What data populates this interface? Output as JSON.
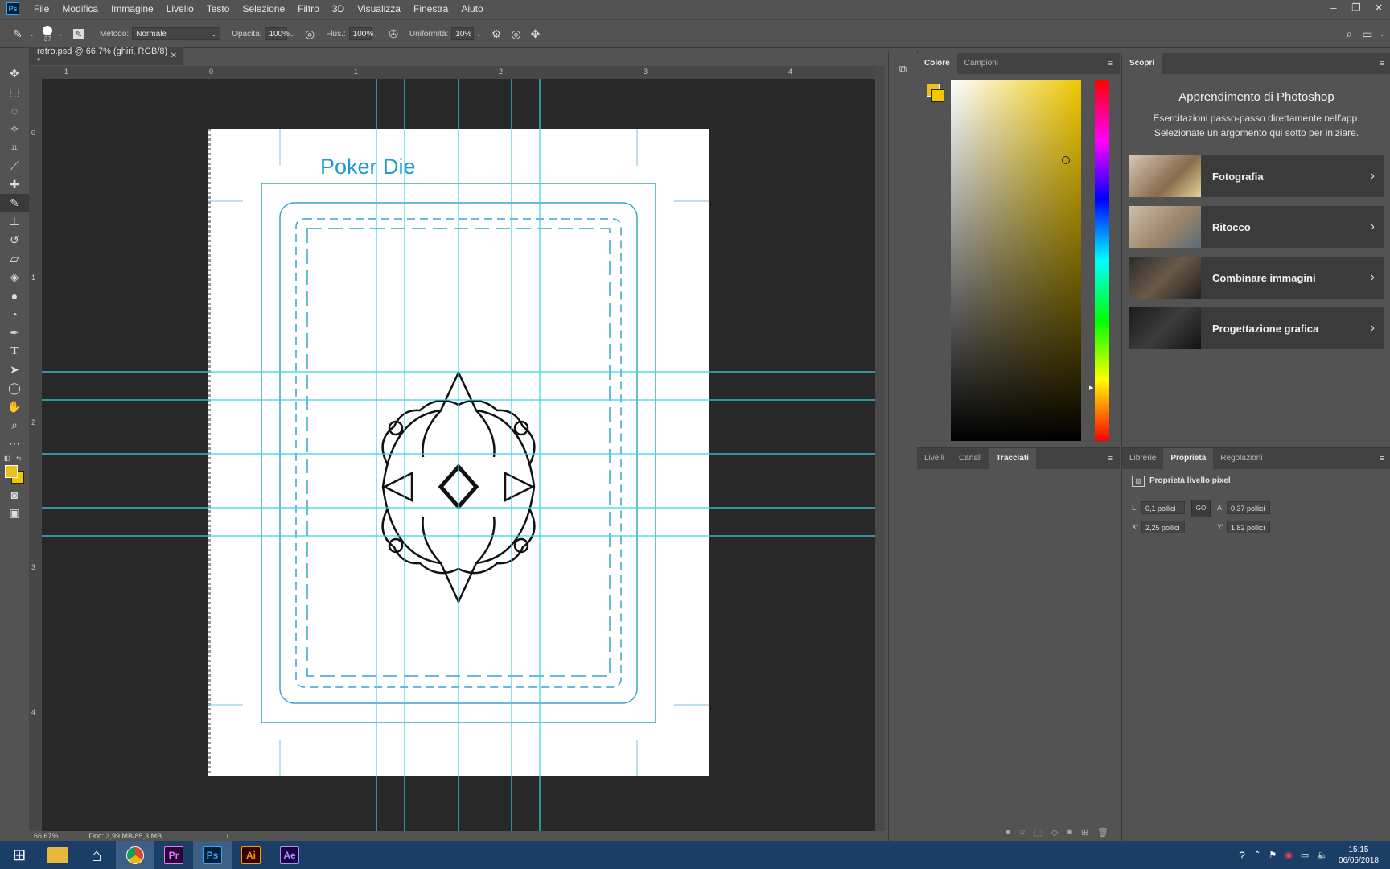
{
  "menu": {
    "items": [
      "File",
      "Modifica",
      "Immagine",
      "Livello",
      "Testo",
      "Selezione",
      "Filtro",
      "3D",
      "Visualizza",
      "Finestra",
      "Aiuto"
    ]
  },
  "options": {
    "brush_size": "37",
    "method_label": "Metodo:",
    "method_value": "Normale",
    "opacity_label": "Opacità:",
    "opacity_value": "100%",
    "flow_label": "Flus.:",
    "flow_value": "100%",
    "smoothing_label": "Uniformità:",
    "smoothing_value": "10%"
  },
  "document": {
    "tab_title": "retro.psd @ 66,7% (ghiri, RGB/8) *",
    "canvas_title": "Poker Die",
    "zoom": "66,67%",
    "doc_info": "Doc: 3,99 MB/85,3 MB",
    "ruler_top": [
      "1",
      "0",
      "1",
      "2",
      "3",
      "4"
    ],
    "ruler_left": [
      "0",
      "1",
      "2",
      "3",
      "4"
    ]
  },
  "color_panel": {
    "tabs": [
      "Colore",
      "Campioni"
    ],
    "foreground": "#e8c21a",
    "background": "#f0c800"
  },
  "layers_panel": {
    "tabs": [
      "Livelli",
      "Canali",
      "Tracciati"
    ]
  },
  "learn_panel": {
    "tab": "Scopri",
    "title": "Apprendimento di Photoshop",
    "subtitle_1": "Esercitazioni passo-passo direttamente nell'app.",
    "subtitle_2": "Selezionate un argomento qui sotto per iniziare.",
    "cards": [
      "Fotografia",
      "Ritocco",
      "Combinare immagini",
      "Progettazione grafica"
    ]
  },
  "props_panel": {
    "tabs": [
      "Librerie",
      "Proprietà",
      "Regolazioni"
    ],
    "heading": "Proprietà livello pixel",
    "w_label": "L:",
    "w_value": "0,1 pollici",
    "link_label": "GO",
    "h_label": "A:",
    "h_value": "0,37 pollici",
    "x_label": "X:",
    "x_value": "2,25 pollici",
    "y_label": "Y:",
    "y_value": "1,82 pollici"
  },
  "taskbar": {
    "time": "15:15",
    "date": "06/05/2018",
    "apps": [
      "Pr",
      "Ps",
      "Ai",
      "Ae"
    ]
  },
  "colors": {
    "guide": "#35d4ec",
    "design_blue": "#3aa3d0"
  }
}
